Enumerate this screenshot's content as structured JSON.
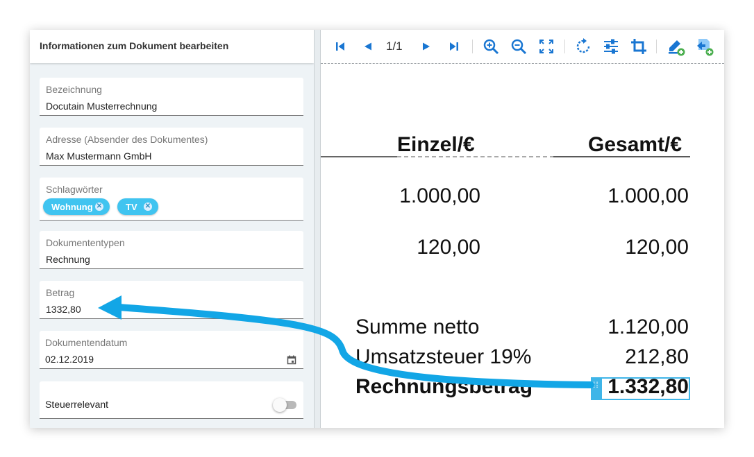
{
  "panel": {
    "title": "Informationen zum Dokument bearbeiten"
  },
  "fields": {
    "bezeichnung": {
      "label": "Bezeichnung",
      "value": "Docutain Musterrechnung"
    },
    "adresse": {
      "label": "Adresse (Absender des Dokumentes)",
      "value": "Max Mustermann GmbH"
    },
    "schlagwoerter": {
      "label": "Schlagwörter",
      "tags": [
        "Wohnung",
        "TV"
      ]
    },
    "dokumententypen": {
      "label": "Dokumententypen",
      "value": "Rechnung"
    },
    "betrag": {
      "label": "Betrag",
      "value": "1332,80"
    },
    "dokumentendatum": {
      "label": "Dokumentendatum",
      "value": "02.12.2019",
      "icon": "calendar-icon"
    },
    "steuerrelevant": {
      "label": "Steuerrelevant",
      "checked": false
    }
  },
  "viewer": {
    "page_indicator": "1/1",
    "colors": {
      "accent": "#1976d2",
      "highlight": "#3fb5e8",
      "tag": "#40c4f0",
      "add_badge": "#4caf50"
    }
  },
  "document": {
    "header_einzel": "Einzel/€",
    "header_gesamt": "Gesamt/€",
    "rows": [
      {
        "einzel": "1.000,00",
        "gesamt": "1.000,00"
      },
      {
        "einzel": "120,00",
        "gesamt": "120,00"
      }
    ],
    "summe_netto_label": "Summe netto",
    "summe_netto_value": "1.120,00",
    "ust_label": "Umsatzsteuer 19%",
    "ust_value": "212,80",
    "rechnungsbetrag_label": "Rechnungsbetrag",
    "rechnungsbetrag_value": "1.332,80"
  }
}
